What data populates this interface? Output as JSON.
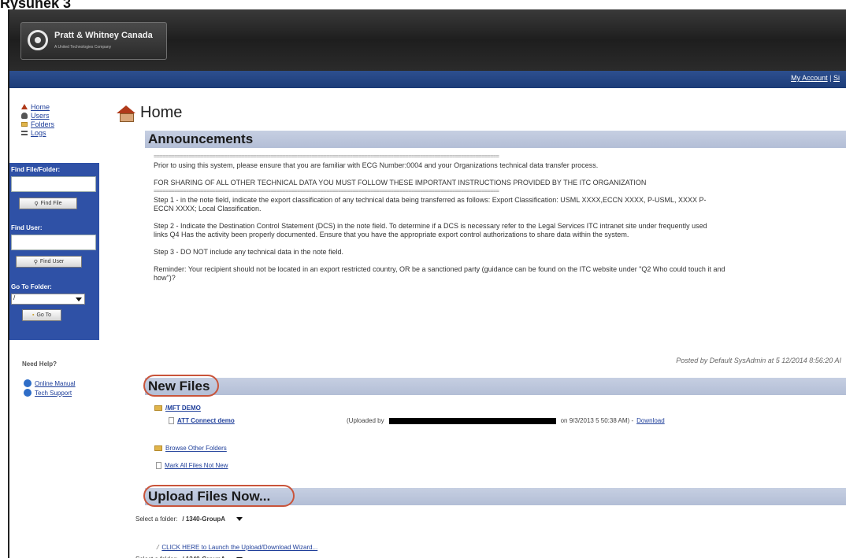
{
  "caption": "Rysunek 3",
  "header": {
    "brand": "Pratt & Whitney Canada",
    "brand_sub": "A United Technologies Company",
    "nav_my_account": "My Account",
    "nav_sep": "|",
    "nav_more": "Si"
  },
  "sidebar": {
    "links": [
      {
        "label": "Home",
        "icon": "home-icon"
      },
      {
        "label": "Users",
        "icon": "users-icon"
      },
      {
        "label": "Folders",
        "icon": "folder-icon"
      },
      {
        "label": "Logs",
        "icon": "logs-icon"
      }
    ],
    "find_file_label": "Find File/Folder:",
    "find_file_btn": "Find File",
    "find_user_label": "Find User:",
    "find_user_btn": "Find User",
    "go_to_folder_label": "Go To Folder:",
    "go_to_folder_value": "/",
    "go_to_btn": "Go To",
    "need_help": "Need Help?",
    "online_manual": "Online Manual",
    "tech_support": "Tech Support"
  },
  "main": {
    "page_title": "Home",
    "announcements_title": "Announcements",
    "eq_line": "======================================================================================================================",
    "a1": "Prior to using this system, please ensure that you are familiar with ECG Number:0004 and your Organizations technical data transfer process.",
    "a2": "FOR SHARING OF ALL OTHER TECHNICAL DATA YOU MUST FOLLOW THESE IMPORTANT INSTRUCTIONS PROVIDED BY THE ITC ORGANIZATION",
    "a3": "Step 1 - in the note field, indicate the export classification of any technical data being transferred as follows: Export Classification: USML XXXX,ECCN XXXX, P-USML, XXXX P-ECCN XXXX; Local Classification.",
    "a4": "Step 2 - Indicate the Destination Control Statement (DCS) in the note field. To determine if a DCS is necessary refer to the Legal Services ITC intranet site under frequently used links Q4 Has the activity been properly documented. Ensure that you have the appropriate export control authorizations to share data within the system.",
    "a5": "Step 3 - DO NOT include any technical data in the note field.",
    "a6": "Reminder: Your recipient should not be located in an export restricted country, OR be a sanctioned party (guidance can be found on the ITC website under \"Q2 Who could touch it and how\")?",
    "posted": "Posted by Default SysAdmin at 5 12/2014 8:56:20 AI",
    "new_files_title": "New Files",
    "folder_name": "/MFT DEMO",
    "file_name": "ATT Connect demo",
    "uploaded_by": "(Uploaded by",
    "uploaded_on": "on 9/3/2013 5 50:38 AM) -",
    "download": "Download",
    "browse_other": "Browse Other Folders",
    "mark_all": "Mark All Files Not New",
    "upload_title": "Upload Files Now...",
    "select_folder_label": "Select a folder:",
    "select_folder_value": "/ 1340-GroupA",
    "wizard_link": "CLICK HERE to Launch the Upload/Download Wizard..."
  },
  "colors": {
    "nav_blue": "#2f51a6",
    "section_bar": "#c6cfe2",
    "circle_highlight": "#c9543a"
  }
}
